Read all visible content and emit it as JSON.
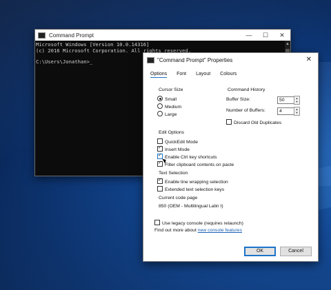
{
  "console": {
    "title": "Command Prompt",
    "controls": {
      "minimize": "—",
      "maximize": "☐",
      "close": "✕"
    },
    "lines": [
      "Microsoft Windows [Version 10.0.14316]",
      "(c) 2016 Microsoft Corporation. All rights reserved."
    ],
    "prompt": "C:\\Users\\Jonathan>"
  },
  "dialog": {
    "title": "\"Command Prompt\" Properties",
    "close": "✕",
    "tabs": [
      "Options",
      "Font",
      "Layout",
      "Colours"
    ],
    "cursor_size": {
      "heading": "Cursor Size",
      "options": [
        "Small",
        "Medium",
        "Large"
      ],
      "selected": "Small"
    },
    "command_history": {
      "heading": "Command History",
      "buffer_size_label": "Buffer Size:",
      "buffer_size_value": "50",
      "num_buffers_label": "Number of Buffers:",
      "num_buffers_value": "4",
      "discard_label": "Discard Old Duplicates"
    },
    "edit_options": {
      "heading": "Edit Options",
      "quickedit": "QuickEdit Mode",
      "insert": "Insert Mode",
      "ctrl_keys": "Enable Ctrl key shortcuts",
      "filter_clipboard": "Filter clipboard contents on paste"
    },
    "text_selection": {
      "heading": "Text Selection",
      "line_wrap": "Enable line wrapping selection",
      "extended_keys": "Extended text selection keys"
    },
    "code_page": {
      "heading": "Current code page",
      "value": "850   (OEM - Multilingual Latin I)"
    },
    "legacy_label": "Use legacy console (requires relaunch)",
    "find_out_text": "Find out more about",
    "find_out_link": "new console features",
    "ok": "OK",
    "cancel": "Cancel"
  },
  "colors": {
    "accent": "#1a73c9",
    "link": "#1a5fb4",
    "console_bg": "#0c0c0c"
  }
}
